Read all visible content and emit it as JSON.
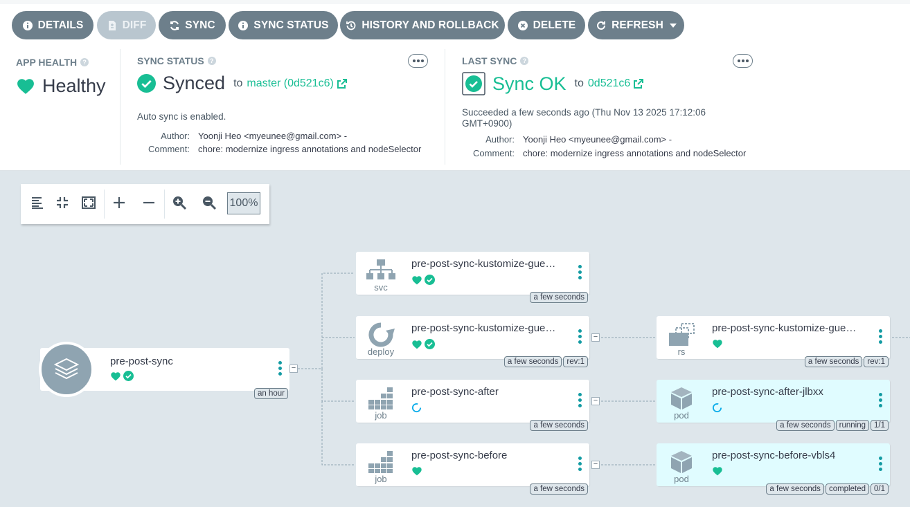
{
  "toolbar": {
    "details": "DETAILS",
    "diff": "DIFF",
    "sync": "SYNC",
    "sync_status": "SYNC STATUS",
    "history": "HISTORY AND ROLLBACK",
    "delete": "DELETE",
    "refresh": "REFRESH"
  },
  "app_health": {
    "title": "APP HEALTH",
    "value": "Healthy",
    "color": "#18be94"
  },
  "sync_status": {
    "title": "SYNC STATUS",
    "value": "Synced",
    "to": "to",
    "revision": "master (0d521c6)",
    "auto_sync": "Auto sync is enabled.",
    "author_label": "Author:",
    "author": "Yoonji Heo <myeunee@gmail.com> -",
    "comment_label": "Comment:",
    "comment": "chore: modernize ingress annotations and nodeSelector"
  },
  "last_sync": {
    "title": "LAST SYNC",
    "value": "Sync OK",
    "to": "to",
    "revision": "0d521c6",
    "succeeded": "Succeeded a few seconds ago (Thu Nov 13 2025 17:12:06 GMT+0900)",
    "author_label": "Author:",
    "author": "Yoonji Heo <myeunee@gmail.com> -",
    "comment_label": "Comment:",
    "comment": "chore: modernize ingress annotations and nodeSelector"
  },
  "graph_tools": {
    "zoom": "100%"
  },
  "app_node": {
    "name": "pre-post-sync",
    "age": "an hour"
  },
  "nodes": {
    "svc": {
      "kind": "svc",
      "name": "pre-post-sync-kustomize-gue…",
      "age": "a few seconds"
    },
    "deploy": {
      "kind": "deploy",
      "name": "pre-post-sync-kustomize-gue…",
      "age": "a few seconds",
      "rev": "rev:1"
    },
    "job_after": {
      "kind": "job",
      "name": "pre-post-sync-after",
      "age": "a few seconds"
    },
    "job_before": {
      "kind": "job",
      "name": "pre-post-sync-before",
      "age": "a few seconds"
    },
    "rs": {
      "kind": "rs",
      "name": "pre-post-sync-kustomize-gue…",
      "age": "a few seconds",
      "rev": "rev:1"
    },
    "pod_after": {
      "kind": "pod",
      "name": "pre-post-sync-after-jlbxx",
      "age": "a few seconds",
      "state": "running",
      "ready": "1/1"
    },
    "pod_before": {
      "kind": "pod",
      "name": "pre-post-sync-before-vbls4",
      "age": "a few seconds",
      "state": "completed",
      "ready": "0/1"
    }
  },
  "colors": {
    "healthy": "#18be94",
    "progressing": "#0dadea",
    "button": "#6d7f8b",
    "accent": "#139ba3"
  }
}
